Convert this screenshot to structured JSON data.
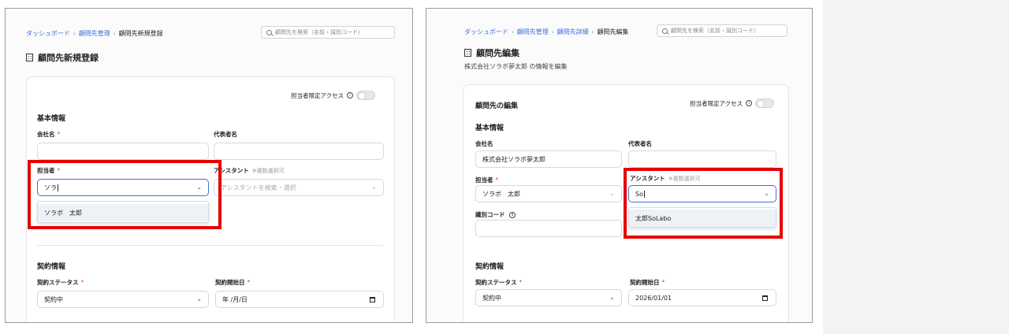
{
  "left": {
    "breadcrumbs": [
      "ダッシュボード",
      "顧問先管理",
      "顧問先新規登録"
    ],
    "search_placeholder": "顧問先を検索（名前・識別コード）",
    "page_title": "顧問先新規登録",
    "toggle_label": "担当者限定アクセス",
    "info_glyph": "i",
    "basic_section": "基本情報",
    "company_label": "会社名",
    "representative_label": "代表者名",
    "person_label": "担当者",
    "assistant_label": "アシスタント",
    "assistant_note": "※複数選択可",
    "person_input_value": "ソラ",
    "assistant_placeholder": "アシスタントを検索・選択",
    "dropdown_option": "ソラボ　太郎",
    "contract_section": "契約情報",
    "contract_status_label": "契約ステータス",
    "contract_start_label": "契約開始日",
    "contract_status_value": "契約中",
    "contract_start_value": "年 /月/日"
  },
  "right": {
    "breadcrumbs": [
      "ダッシュボード",
      "顧問先管理",
      "顧問先詳細",
      "顧問先編集"
    ],
    "search_placeholder": "顧問先を検索（名前・識別コード）",
    "page_title": "顧問先編集",
    "subtitle": "株式会社ソラボ夢太郎 の情報を編集",
    "card_title": "顧問先の編集",
    "toggle_label": "担当者限定アクセス",
    "info_glyph": "i",
    "basic_section": "基本情報",
    "company_label": "会社名",
    "representative_label": "代表者名",
    "company_value": "株式会社ソラボ夢太郎",
    "person_label": "担当者",
    "assistant_label": "アシスタント",
    "assistant_note": "※複数選択可",
    "person_value": "ソラボ　太郎",
    "assistant_input_value": "So",
    "dropdown_option": "太郎SoLabo",
    "code_label": "識別コード",
    "contract_section": "契約情報",
    "contract_status_label": "契約ステータス",
    "contract_start_label": "契約開始日",
    "contract_status_value": "契約中",
    "contract_start_value": "2026/01/01"
  },
  "required_mark": "*",
  "breadcrumb_separator": "›",
  "chevron_glyph": "⌄",
  "colors": {
    "accent": "#3f6fd8",
    "highlight": "#e60000",
    "required": "#e04848"
  }
}
